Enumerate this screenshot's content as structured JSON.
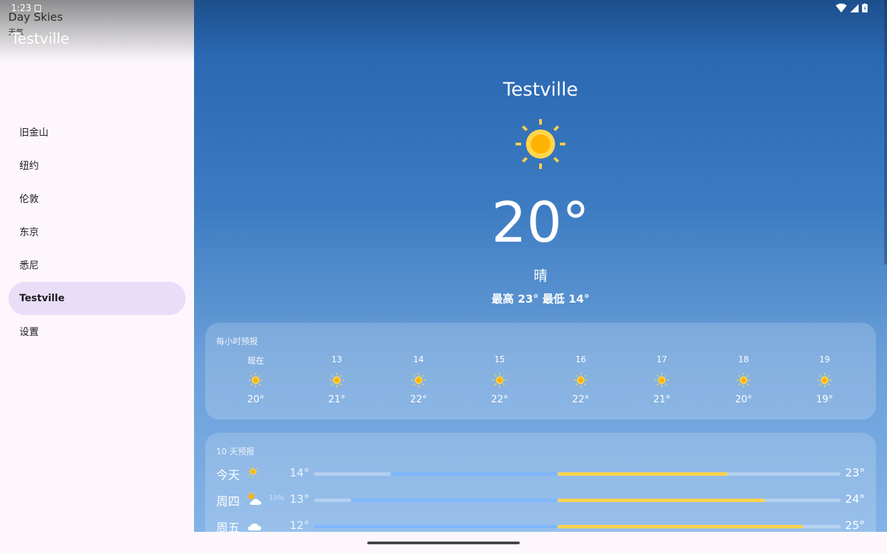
{
  "status": {
    "time": "1:23"
  },
  "app": {
    "name": "Day Skies",
    "subtitle": "天气"
  },
  "drawer": {
    "city": "Testville",
    "items": [
      {
        "label": "旧金山"
      },
      {
        "label": "纽约"
      },
      {
        "label": "伦敦"
      },
      {
        "label": "东京"
      },
      {
        "label": "悉尼"
      },
      {
        "label": "Testville",
        "selected": true
      },
      {
        "label": "设置"
      }
    ]
  },
  "current": {
    "city": "Testville",
    "icon": "sun-icon",
    "temp": "20°",
    "condition": "晴",
    "hilo": "最高 23° 最低 14°"
  },
  "hourly": {
    "title": "每小时预报",
    "items": [
      {
        "label": "现在",
        "icon": "sun-icon",
        "temp": "20°"
      },
      {
        "label": "13",
        "icon": "sun-icon",
        "temp": "21°"
      },
      {
        "label": "14",
        "icon": "sun-icon",
        "temp": "22°"
      },
      {
        "label": "15",
        "icon": "sun-icon",
        "temp": "22°"
      },
      {
        "label": "16",
        "icon": "sun-icon",
        "temp": "22°"
      },
      {
        "label": "17",
        "icon": "sun-icon",
        "temp": "21°"
      },
      {
        "label": "18",
        "icon": "sun-icon",
        "temp": "20°"
      },
      {
        "label": "19",
        "icon": "sun-icon",
        "temp": "19°"
      }
    ]
  },
  "daily": {
    "title": "10 天预报",
    "items": [
      {
        "day": "今天",
        "icon": "sun-icon",
        "precip": "",
        "low": "14°",
        "high": "23°",
        "range_start": 0.145,
        "range_end": 0.785
      },
      {
        "day": "周四",
        "icon": "partly-cloudy-icon",
        "precip": "10%",
        "low": "13°",
        "high": "24°",
        "range_start": 0.07,
        "range_end": 0.857
      },
      {
        "day": "周五",
        "icon": "cloud-icon",
        "precip": "",
        "low": "12°",
        "high": "25°",
        "range_start": 0.0,
        "range_end": 0.929
      }
    ]
  },
  "colors": {
    "accent": "#ffc107",
    "sun_ray": "#ffcf4a",
    "bar_cool": "#7fb8ff",
    "bar_warm": "#ffd44d",
    "selected_item_bg": "#e8def8"
  }
}
